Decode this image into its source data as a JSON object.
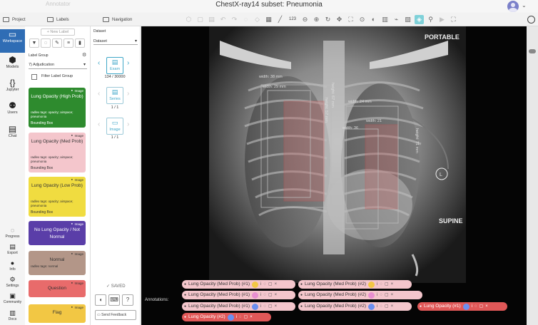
{
  "app": {
    "ghost_name": "Annotator",
    "title": "ChestX-ray14 subset: Pneumonia"
  },
  "tabs": {
    "project": "Project",
    "labels": "Labels",
    "navigation": "Navigation"
  },
  "toolbar": {
    "counter": "123"
  },
  "left_nav": {
    "items": [
      {
        "label": "Workspace",
        "icon": "image-icon"
      },
      {
        "label": "Models",
        "icon": "cube-icon"
      },
      {
        "label": "Jupyter",
        "icon": "braces-icon"
      },
      {
        "label": "Users",
        "icon": "users-icon"
      },
      {
        "label": "Chat",
        "icon": "chat-icon"
      }
    ],
    "bottom_items": [
      {
        "label": "Progress",
        "icon": "progress-icon"
      },
      {
        "label": "Export",
        "icon": "export-icon"
      },
      {
        "label": "Info",
        "icon": "info-icon"
      },
      {
        "label": "Settings",
        "icon": "gear-icon"
      },
      {
        "label": "Community",
        "icon": "community-icon"
      },
      {
        "label": "Docs",
        "icon": "book-icon"
      }
    ]
  },
  "labels_panel": {
    "new_label": "+ New Label",
    "group_label": "Label Group",
    "group_value": "7) Adjudication",
    "filter_label": "Filter Label Group",
    "cards": [
      {
        "name": "Lung Opacity (High Prob)",
        "badge": "Image",
        "tags": "radlex tags: opacity; airspace; pneumonia",
        "type": "Bounding Box",
        "bg": "#2e8b2e",
        "fg": "#ffffff"
      },
      {
        "name": "Lung Opacity (Med Prob)",
        "badge": "Image",
        "tags": "radlex tags: opacity; airspace; pneumonia",
        "type": "Bounding Box",
        "bg": "#f4c6cc",
        "fg": "#333333"
      },
      {
        "name": "Lung Opacity (Low Prob)",
        "badge": "Image",
        "tags": "radlex tags: opacity; airspace; pneumonia",
        "type": "Bounding Box",
        "bg": "#f0dc40",
        "fg": "#333333"
      },
      {
        "name": "No Lung Opacity / Not Normal",
        "badge": "Image",
        "tags": "",
        "type": "",
        "bg": "#5a3ea8",
        "fg": "#ffffff"
      },
      {
        "name": "Normal",
        "badge": "Image",
        "tags": "radlex tags: normal",
        "type": "",
        "bg": "#b39688",
        "fg": "#333333"
      },
      {
        "name": "Question",
        "badge": "Image",
        "tags": "",
        "type": "",
        "bg": "#e86b6b",
        "fg": "#333333"
      },
      {
        "name": "Flag",
        "badge": "Image",
        "tags": "",
        "type": "",
        "bg": "#f2c744",
        "fg": "#333333"
      }
    ]
  },
  "navigation_panel": {
    "dataset_label": "Dataset",
    "dataset_value": "Dataset",
    "exam_label": "Exam",
    "exam_count": "134 / 30000",
    "series_label": "Series",
    "series_count": "1 / 1",
    "image_label": "Image",
    "image_count": "1 / 1",
    "saved": "✓ SAVED",
    "feedback": "Send Feedback"
  },
  "viewer": {
    "overlay_portable": "PORTABLE",
    "overlay_supine": "SUPINE",
    "marker": "L",
    "measure_width_1": "width: 38 mm",
    "measure_width_2": "width: 29 mm",
    "measure_width_3": "width: 24 mm",
    "measure_width_4": "width: 36",
    "measure_width_5": "width: 21",
    "measure_height_1": "height: 67 mm",
    "measure_height_2": "height: 57 mm",
    "measure_height_3": "height: 71 mm"
  },
  "annotations": {
    "label": "Annotations:",
    "chips": [
      {
        "text": "Lung Opacity (Med Prob) (#1)",
        "bg": "#f4c6cc",
        "avatar": "#f2c744"
      },
      {
        "text": "Lung Opacity (Med Prob) (#2)",
        "bg": "#f4c6cc",
        "avatar": "#f2c744"
      },
      {
        "text": "Lung Opacity (Med Prob) (#1)",
        "bg": "#f4c6cc",
        "avatar": "#e88fd0"
      },
      {
        "text": "Lung Opacity (Med Prob) (#2)",
        "bg": "#f4c6cc",
        "avatar": "#e88fd0"
      },
      {
        "text": "Lung Opacity (Med Prob) (#1)",
        "bg": "#f4c6cc",
        "avatar": "#6b8ff0"
      },
      {
        "text": "Lung Opacity (Med Prob) (#2)",
        "bg": "#f4c6cc",
        "avatar": "#6b8ff0"
      },
      {
        "text": "Lung Opacity (#1)",
        "bg": "#e05858",
        "avatar": "#6b8ff0"
      },
      {
        "text": "Lung Opacity (#2)",
        "bg": "#e05858",
        "avatar": "#6b8ff0"
      }
    ]
  }
}
